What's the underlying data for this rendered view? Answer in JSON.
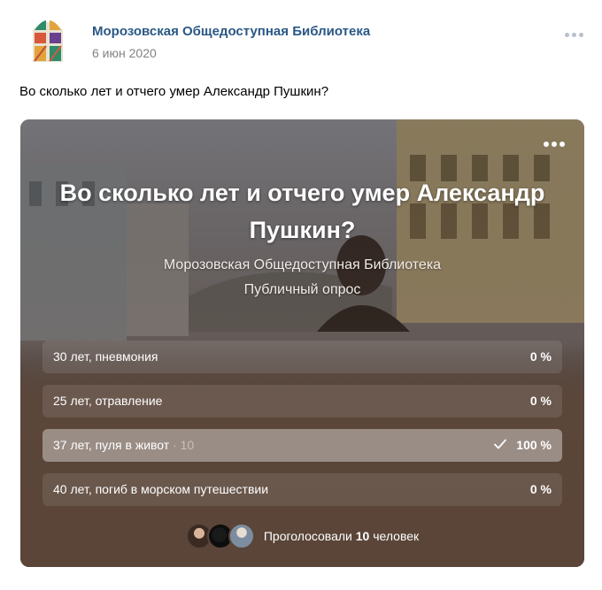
{
  "post": {
    "author": "Морозовская Общедоступная Библиотека",
    "date": "6 июн 2020",
    "text": "Во сколько лет и отчего умер Александр Пушкин?"
  },
  "poll": {
    "title": "Во сколько лет и отчего умер Александр Пушкин?",
    "owner": "Морозовская Общедоступная Библиотека",
    "type": "Публичный опрос",
    "answers": [
      {
        "label": "30 лет, пневмония",
        "count": "",
        "percent": "0 %",
        "share": 0,
        "chosen": false
      },
      {
        "label": "25 лет, отравление",
        "count": "",
        "percent": "0 %",
        "share": 0,
        "chosen": false
      },
      {
        "label": "37 лет, пуля в живот",
        "count": " · 10",
        "percent": "100 %",
        "share": 1,
        "chosen": true
      },
      {
        "label": "40 лет, погиб в морском путешествии",
        "count": "",
        "percent": "0 %",
        "share": 0,
        "chosen": false
      }
    ],
    "voters_prefix": "Проголосовали ",
    "voters_count": "10",
    "voters_suffix": " человек"
  },
  "icons": {
    "post_more": "more-horizontal-icon",
    "poll_more": "more-horizontal-icon",
    "check": "check-icon"
  },
  "colors": {
    "author_link": "#2a5885",
    "date": "#828282",
    "poll_background": "#5a4538"
  }
}
